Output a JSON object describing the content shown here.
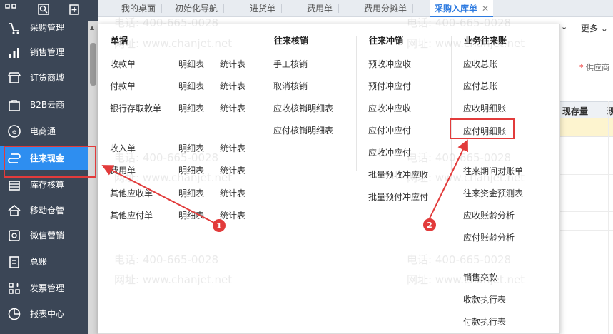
{
  "tabs": [
    {
      "label": "我的桌面"
    },
    {
      "label": "初始化导航"
    },
    {
      "label": "进货单"
    },
    {
      "label": "费用单"
    },
    {
      "label": "费用分摊单"
    },
    {
      "label": "采购入库单",
      "close": "✕"
    }
  ],
  "sidebar": {
    "items": [
      {
        "label": "采购管理"
      },
      {
        "label": "销售管理"
      },
      {
        "label": "订货商城"
      },
      {
        "label": "B2B云商"
      },
      {
        "label": "电商通"
      },
      {
        "label": "往来现金"
      },
      {
        "label": "库存核算"
      },
      {
        "label": "移动仓管"
      },
      {
        "label": "微信营销"
      },
      {
        "label": "总账"
      },
      {
        "label": "发票管理"
      },
      {
        "label": "报表中心"
      }
    ]
  },
  "background": {
    "more": "更多",
    "supplier_required": "*",
    "supplier_label": "供应商",
    "col_stock": "现存量",
    "col_next": "现"
  },
  "menu": {
    "col1": {
      "header": "单据",
      "rows": [
        {
          "name": "收款单",
          "detail": "明细表",
          "stat": "统计表"
        },
        {
          "name": "付款单",
          "detail": "明细表",
          "stat": "统计表"
        },
        {
          "name": "银行存取款单",
          "detail": "明细表",
          "stat": "统计表"
        },
        {
          "name": "收入单",
          "detail": "明细表",
          "stat": "统计表"
        },
        {
          "name": "费用单",
          "detail": "明细表",
          "stat": "统计表"
        },
        {
          "name": "其他应收单",
          "detail": "明细表",
          "stat": "统计表"
        },
        {
          "name": "其他应付单",
          "detail": "明细表",
          "stat": "统计表"
        }
      ]
    },
    "col2": {
      "header": "往来核销",
      "items": [
        "手工核销",
        "取消核销",
        "应收核销明细表",
        "应付核销明细表"
      ]
    },
    "col3": {
      "header": "往来冲销",
      "items": [
        "预收冲应收",
        "预付冲应付",
        "应收冲应收",
        "应付冲应付",
        "应收冲应付",
        "批量预收冲应收",
        "批量预付冲应付"
      ]
    },
    "col4": {
      "header": "业务往来账",
      "items": [
        "应收总账",
        "应付总账",
        "应收明细账",
        "应付明细账",
        "往来期间对账单",
        "往来资金预测表",
        "应收账龄分析",
        "应付账龄分析",
        "销售交款",
        "收款执行表",
        "付款执行表"
      ]
    }
  },
  "watermark": {
    "phone": "电话: 400-665-0028",
    "site": "网址: www.chanjet.net"
  },
  "annotations": {
    "badge1": "1",
    "badge2": "2",
    "color": "#e23b3b"
  }
}
